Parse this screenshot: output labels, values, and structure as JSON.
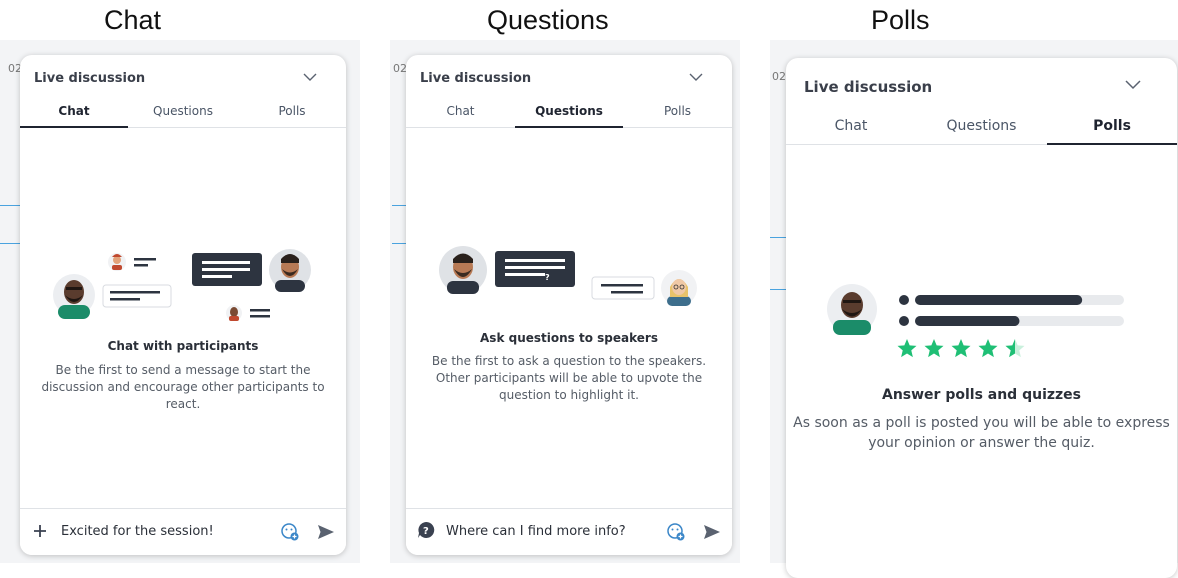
{
  "captions": [
    "Chat",
    "Questions",
    "Polls"
  ],
  "panels": [
    {
      "title": "Live discussion",
      "tabs": [
        "Chat",
        "Questions",
        "Polls"
      ],
      "active_tab": 0,
      "heading": "Chat with participants",
      "description": "Be the first to send a message to start the discussion and encourage other participants to react.",
      "composer_text": "Excited for the session!"
    },
    {
      "title": "Live discussion",
      "tabs": [
        "Chat",
        "Questions",
        "Polls"
      ],
      "active_tab": 1,
      "heading": "Ask questions to speakers",
      "description": "Be the first to ask a question to the speakers. Other participants will be able to upvote the question to highlight it.",
      "composer_text": "Where can I find more info?",
      "bubble_mark": "?"
    },
    {
      "title": "Live discussion",
      "tabs": [
        "Chat",
        "Questions",
        "Polls"
      ],
      "active_tab": 2,
      "heading": "Answer polls and quizzes",
      "description": "As soon as a poll is posted you will be able to express your opinion or answer the quiz.",
      "poll_results": [
        0.8,
        0.5
      ],
      "rating": 4.5,
      "rating_max": 5
    }
  ],
  "background": {
    "edge_text": [
      "02",
      "02",
      "02"
    ]
  },
  "icons": {
    "chevron": "chevron-down-icon",
    "plus": "plus-icon",
    "question": "question-bubble-icon",
    "emoji": "emoji-add-icon",
    "send": "send-icon"
  },
  "colors": {
    "accent_dark": "#2d3440",
    "star_green": "#1fbf75",
    "skin_dark": "#5a3c2e",
    "shirt_green": "#1b8c69"
  }
}
